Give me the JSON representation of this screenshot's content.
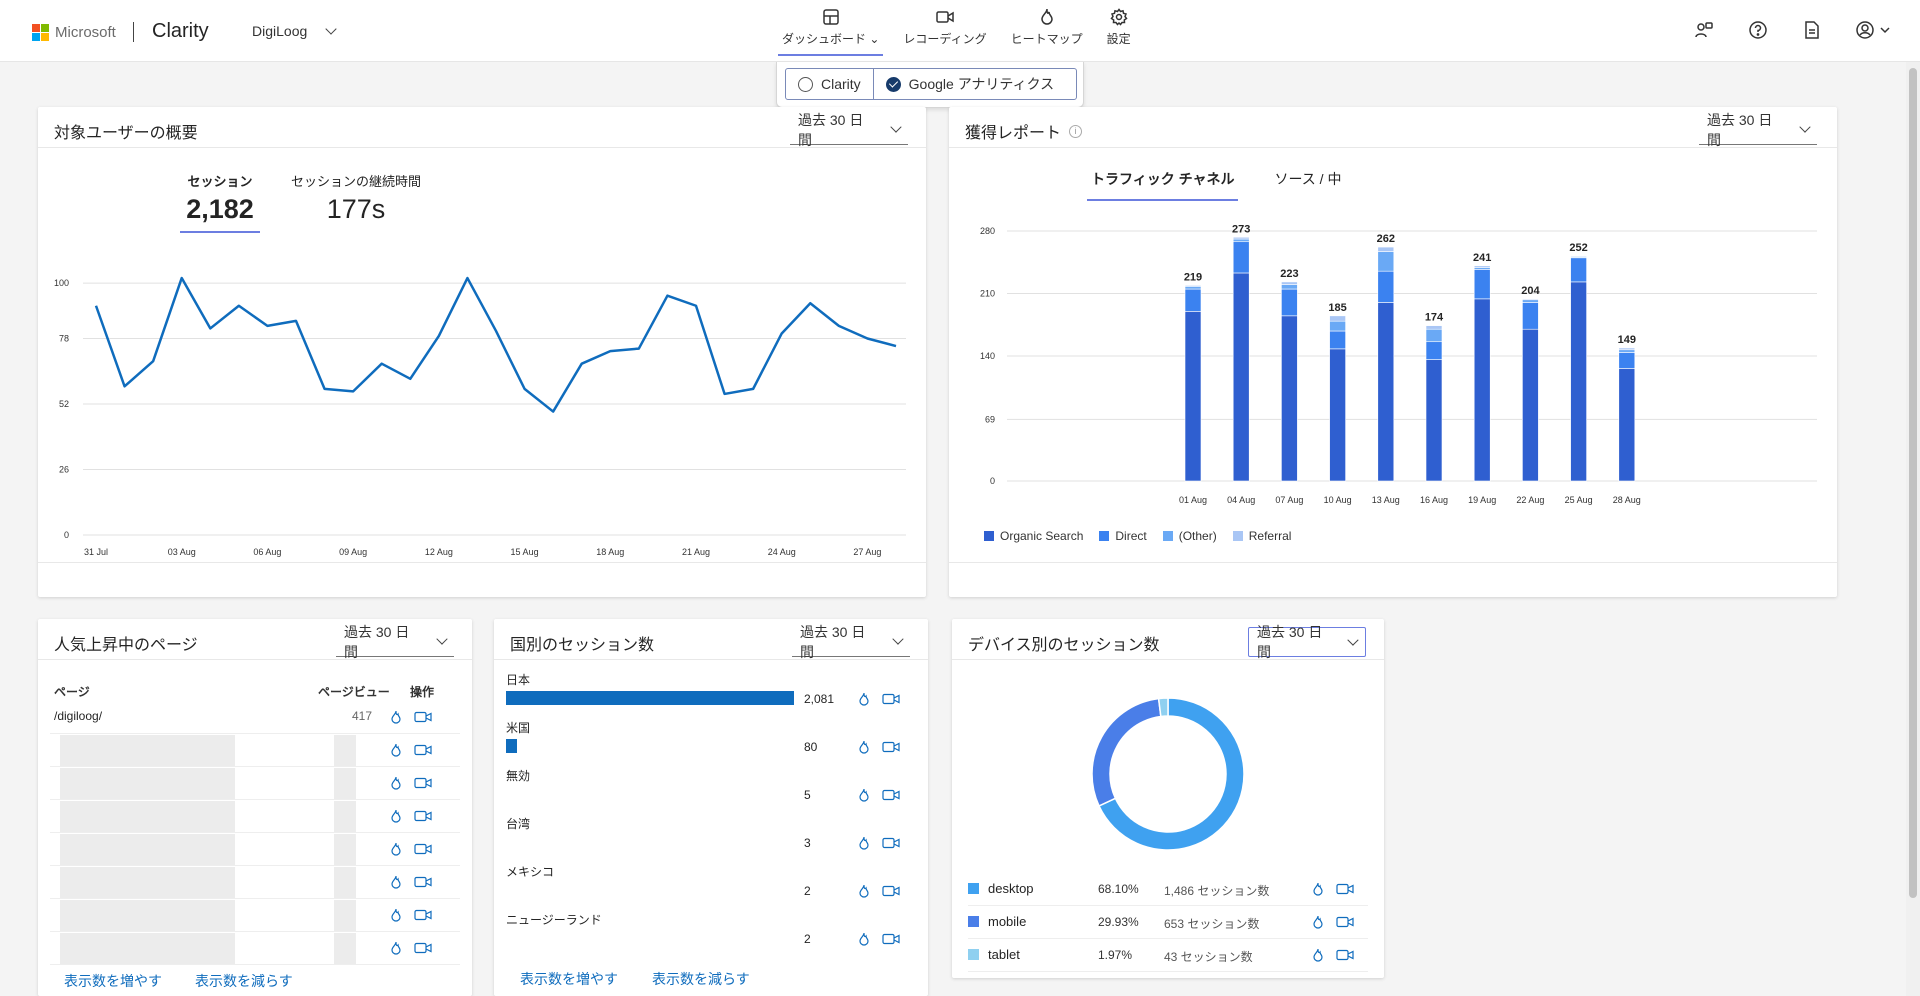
{
  "header": {
    "brand": "Microsoft",
    "app": "Clarity",
    "project": "DigiLoog",
    "nav": [
      {
        "label": "ダッシュボード",
        "icon": "dashboard-icon"
      },
      {
        "label": "レコーディング",
        "icon": "video-icon"
      },
      {
        "label": "ヒートマップ",
        "icon": "flame-icon"
      },
      {
        "label": "設定",
        "icon": "gear-icon"
      }
    ],
    "right_icons": [
      "share-icon",
      "help-icon",
      "document-icon",
      "account-icon"
    ]
  },
  "source_toggle": {
    "options": [
      "Clarity",
      "Google アナリティクス"
    ],
    "selected": "Google アナリティクス"
  },
  "audience": {
    "title": "対象ユーザーの概要",
    "range": "過去 30 日間",
    "metric1_label": "セッション",
    "metric1_value": "2,182",
    "metric2_label": "セッションの継続時間",
    "metric2_value": "177s"
  },
  "acquisition": {
    "title": "獲得レポート",
    "range": "過去 30 日間",
    "tab1": "トラフィック チャネル",
    "tab2": "ソース / 中"
  },
  "popular_pages": {
    "title": "人気上昇中のページ",
    "range": "過去 30 日間",
    "col_page": "ページ",
    "col_views": "ページビュー",
    "col_actions": "操作",
    "first_page": "/digiloog/",
    "first_views": "417",
    "more": "表示数を増やす",
    "less": "表示数を減らす"
  },
  "countries": {
    "title": "国別のセッション数",
    "range": "過去 30 日間",
    "rows": [
      {
        "name": "日本",
        "value": "2,081",
        "num": 2081
      },
      {
        "name": "米国",
        "value": "80",
        "num": 80
      },
      {
        "name": "無効",
        "value": "5",
        "num": 5
      },
      {
        "name": "台湾",
        "value": "3",
        "num": 3
      },
      {
        "name": "メキシコ",
        "value": "2",
        "num": 2
      },
      {
        "name": "ニュージーランド",
        "value": "2",
        "num": 2
      }
    ],
    "more": "表示数を増やす",
    "less": "表示数を減らす"
  },
  "devices": {
    "title": "デバイス別のセッション数",
    "range": "過去 30 日間",
    "rows": [
      {
        "name": "desktop",
        "pct": "68.10%",
        "sessions": "1,486 セッション数",
        "color": "#3fa1f0",
        "share": 68.1
      },
      {
        "name": "mobile",
        "pct": "29.93%",
        "sessions": "653 セッション数",
        "color": "#4a7ee8",
        "share": 29.93
      },
      {
        "name": "tablet",
        "pct": "1.97%",
        "sessions": "43 セッション数",
        "color": "#8fd0f0",
        "share": 1.97
      }
    ]
  },
  "chart_data": [
    {
      "type": "line",
      "x_ticks": [
        "31 Jul",
        "03 Aug",
        "06 Aug",
        "09 Aug",
        "12 Aug",
        "15 Aug",
        "18 Aug",
        "21 Aug",
        "24 Aug",
        "27 Aug"
      ],
      "y_ticks": [
        "0",
        "26",
        "52",
        "78",
        "100"
      ],
      "ylim": [
        0,
        104
      ],
      "color": "#0f6cbd",
      "values": [
        91,
        59,
        69,
        102,
        82,
        91,
        83,
        85,
        58,
        57,
        68,
        62,
        79,
        102,
        81,
        58,
        49,
        68,
        73,
        74,
        95,
        91,
        56,
        58,
        80,
        92,
        83,
        78,
        75
      ]
    },
    {
      "type": "bar",
      "stacked": true,
      "categories": [
        "01 Aug",
        "04 Aug",
        "07 Aug",
        "10 Aug",
        "13 Aug",
        "16 Aug",
        "19 Aug",
        "22 Aug",
        "25 Aug",
        "28 Aug"
      ],
      "totals": [
        219,
        273,
        223,
        185,
        262,
        174,
        241,
        204,
        252,
        149
      ],
      "y_ticks": [
        "0",
        "69",
        "140",
        "210",
        "280"
      ],
      "ylim": [
        0,
        280
      ],
      "series": [
        {
          "name": "Organic Search",
          "color": "#2f5fd0",
          "values": [
            190,
            233,
            185,
            148,
            200,
            136,
            204,
            170,
            223,
            126
          ]
        },
        {
          "name": "Direct",
          "color": "#3b82f0",
          "values": [
            25,
            35,
            30,
            20,
            35,
            20,
            33,
            30,
            27,
            18
          ]
        },
        {
          "name": "(Other)",
          "color": "#6aa9f5",
          "values": [
            3,
            3,
            5,
            11,
            22,
            14,
            2,
            3,
            1,
            3
          ]
        },
        {
          "name": "Referral",
          "color": "#a9c6f5",
          "values": [
            1,
            2,
            3,
            6,
            5,
            4,
            2,
            1,
            1,
            2
          ]
        }
      ]
    }
  ]
}
